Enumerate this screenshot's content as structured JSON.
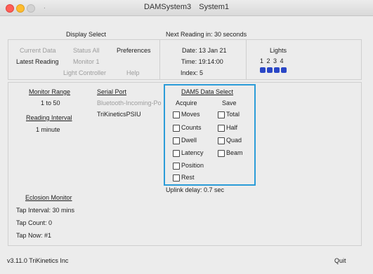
{
  "window": {
    "app_name": "DAMSystem3",
    "system_name": "System1",
    "title_dot": "."
  },
  "header": {
    "display_select": "Display Select",
    "next_reading": "Next Reading in: 30 seconds"
  },
  "display_menu": {
    "current_data": "Current Data",
    "status_all": "Status All",
    "preferences": "Preferences",
    "latest_reading": "Latest Reading",
    "monitor_1": "Monitor 1",
    "light_controller": "Light Controller",
    "help": "Help"
  },
  "info": {
    "date": "Date: 13 Jan 21",
    "time": "Time: 19:14:00",
    "index": "Index: 5"
  },
  "lights": {
    "title": "Lights",
    "numbers": "1 2 3 4",
    "count": 4,
    "color": "#2a47c6"
  },
  "monitor": {
    "range_title": "Monitor Range",
    "range_value": "1 to 50",
    "interval_title": "Reading Interval",
    "interval_value": "1 minute"
  },
  "serial": {
    "title": "Serial Port",
    "option_1": "Bluetooth-Incoming-Po",
    "option_2": "TriKineticsPSIU"
  },
  "dam5": {
    "title": "DAM5 Data Select",
    "acquire_header": "Acquire",
    "save_header": "Save",
    "acquire": [
      "Moves",
      "Counts",
      "Dwell",
      "Latency",
      "Position",
      "Rest"
    ],
    "save": [
      "Total",
      "Half",
      "Quad",
      "Beam"
    ],
    "highlight_color": "#2b9cd8"
  },
  "uplink": "Uplink delay: 0.7 sec",
  "eclosion": {
    "title": "Eclosion Monitor",
    "tap_interval": "Tap Interval: 30 mins",
    "tap_count": "Tap Count: 0",
    "tap_now": "Tap Now: #1"
  },
  "footer": {
    "version": "v3.11.0  TriKinetics Inc",
    "quit": "Quit"
  }
}
